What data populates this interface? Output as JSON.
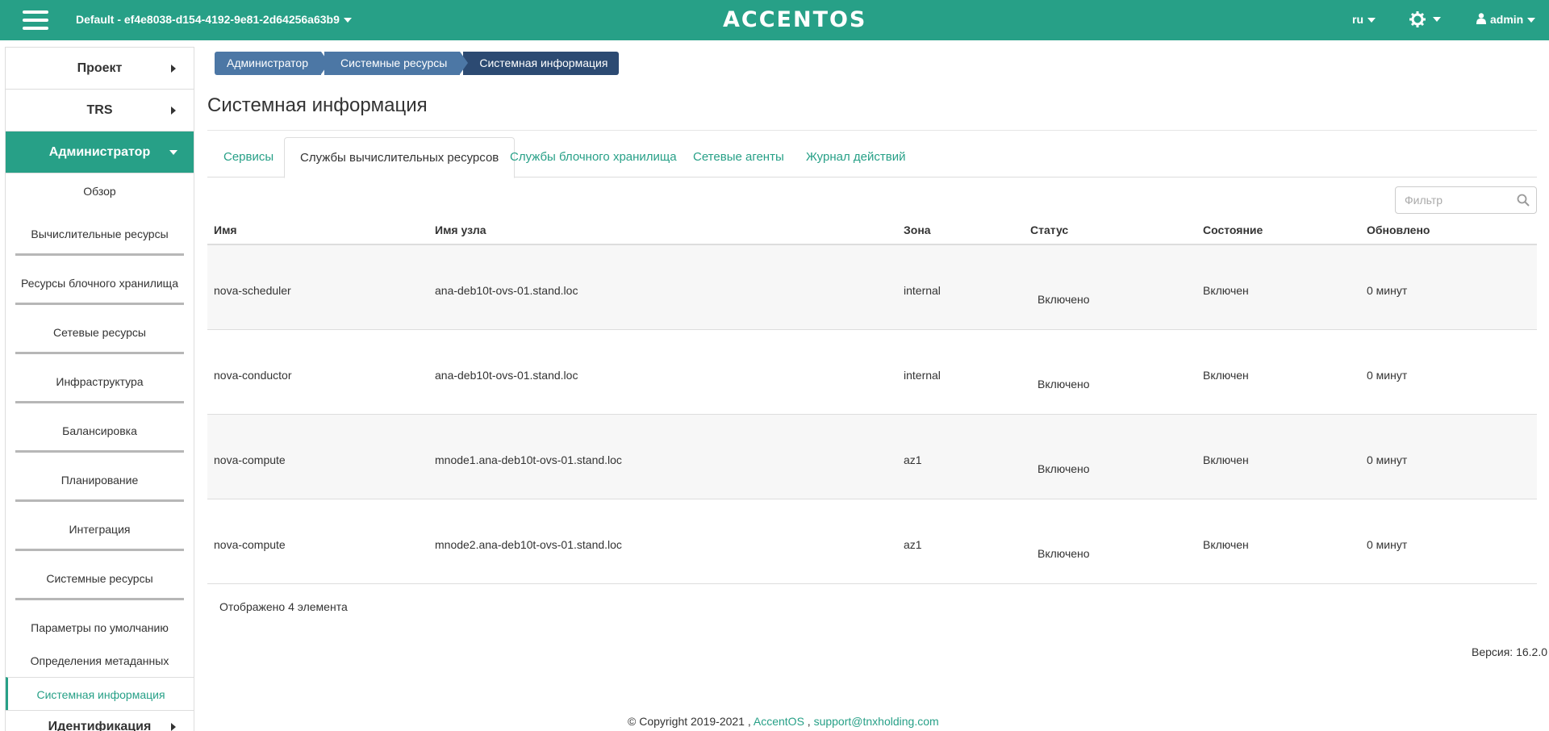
{
  "topbar": {
    "project": "Default - ef4e8038-d154-4192-9e81-2d64256a63b9",
    "logo": "ACCENTOS",
    "language": "ru",
    "user": "admin",
    "accent_color": "#27a087"
  },
  "sidebar": {
    "sections": [
      {
        "label": "Проект"
      },
      {
        "label": "TRS"
      },
      {
        "label": "Администратор"
      }
    ],
    "admin_items": [
      {
        "label": "Обзор"
      },
      {
        "label": "Вычислительные ресурсы"
      },
      {
        "label": "Ресурсы блочного хранилища"
      },
      {
        "label": "Сетевые ресурсы"
      },
      {
        "label": "Инфраструктура"
      },
      {
        "label": "Балансировка"
      },
      {
        "label": "Планирование"
      },
      {
        "label": "Интеграция"
      },
      {
        "label": "Системные ресурсы"
      }
    ],
    "system_sub": [
      {
        "label": "Параметры по умолчанию"
      },
      {
        "label": "Определения метаданных"
      },
      {
        "label": "Системная информация"
      }
    ],
    "identity": "Идентификация"
  },
  "breadcrumb": [
    "Администратор",
    "Системные ресурсы",
    "Системная информация"
  ],
  "page_title": "Системная информация",
  "tabs": [
    {
      "label": "Сервисы"
    },
    {
      "label": "Службы вычислительных ресурсов"
    },
    {
      "label": "Службы блочного хранилища"
    },
    {
      "label": "Сетевые агенты"
    },
    {
      "label": "Журнал действий"
    }
  ],
  "filter": {
    "placeholder": "Фильтр"
  },
  "table": {
    "columns": [
      "Имя",
      "Имя узла",
      "Зона",
      "Статус",
      "Состояние",
      "Обновлено"
    ],
    "rows": [
      {
        "name": "nova-scheduler",
        "host": "ana-deb10t-ovs-01.stand.loc",
        "zone": "internal",
        "status": "Включено",
        "state": "Включен",
        "updated": "0 минут"
      },
      {
        "name": "nova-conductor",
        "host": "ana-deb10t-ovs-01.stand.loc",
        "zone": "internal",
        "status": "Включено",
        "state": "Включен",
        "updated": "0 минут"
      },
      {
        "name": "nova-compute",
        "host": "mnode1.ana-deb10t-ovs-01.stand.loc",
        "zone": "az1",
        "status": "Включено",
        "state": "Включен",
        "updated": "0 минут"
      },
      {
        "name": "nova-compute",
        "host": "mnode2.ana-deb10t-ovs-01.stand.loc",
        "zone": "az1",
        "status": "Включено",
        "state": "Включен",
        "updated": "0 минут"
      }
    ],
    "summary": "Отображено 4 элемента"
  },
  "version": "Версия: 16.2.0",
  "footer": {
    "copyright": "© Copyright 2019-2021 ,",
    "link1": "AccentOS",
    "sep": ",",
    "link2": "support@tnxholding.com"
  }
}
